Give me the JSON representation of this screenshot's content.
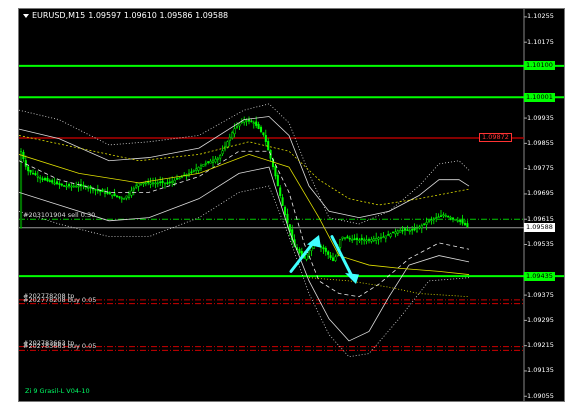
{
  "window": {
    "menu_icon": "dropdown-triangle-icon",
    "symbol": "EURUSD,M15",
    "ohlc": "1.09597 1.09610 1.09586 1.09588"
  },
  "colors": {
    "background": "#000000",
    "candles": "#00ff00",
    "level_green": "#00ff00",
    "level_red": "#b00000",
    "bands": "#ffffff",
    "ma": "#e0e000",
    "arrows": "#40ffff"
  },
  "axis": {
    "ticks": [
      "1.10255",
      "1.10175",
      "1.10100",
      "1.10001",
      "1.09935",
      "1.09855",
      "1.09775",
      "1.09695",
      "1.09615",
      "1.09588",
      "1.09535",
      "1.09435",
      "1.09375",
      "1.09295",
      "1.09215",
      "1.09135",
      "1.09055"
    ],
    "price_top": 1.1028,
    "price_bottom": 1.0904
  },
  "levels": {
    "green": [
      {
        "price": 1.101,
        "label": "1.10100"
      },
      {
        "price": 1.10001,
        "label": "1.10001"
      },
      {
        "price": 1.09435,
        "label": "1.09435"
      }
    ],
    "red": {
      "price": 1.09872,
      "label": "1.09872"
    },
    "current": {
      "price": 1.09588,
      "label": "1.09588"
    }
  },
  "orders": [
    {
      "price": 1.09615,
      "text": "#203101904 sell 0.30",
      "color": "#00cc00"
    },
    {
      "price": 1.0936,
      "text": "#202778208 tp",
      "color": "#cc0000"
    },
    {
      "price": 1.09348,
      "text": "#202778208 buy 0.05",
      "color": "#cc0000"
    },
    {
      "price": 1.09212,
      "text": "#202783663 tp",
      "color": "#cc0000"
    },
    {
      "price": 1.092,
      "text": "#202783663 buy 0.05",
      "color": "#cc0000"
    }
  ],
  "indicator_label": "Zi 9 Grasil-L V04-10"
}
